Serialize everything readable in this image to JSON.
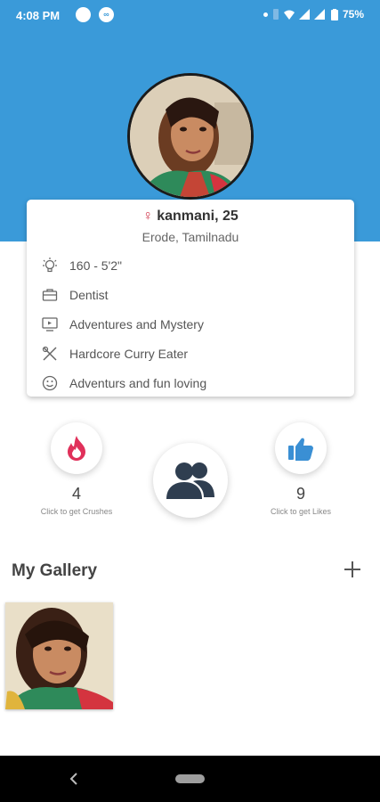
{
  "status_bar": {
    "time": "4:08 PM",
    "app_icon": "∞",
    "battery": "75%"
  },
  "profile": {
    "name_line": "kanmani, 25",
    "gender_symbol": "♀",
    "location": "Erode, Tamilnadu",
    "details": [
      {
        "icon": "bulb-icon",
        "text": "160 - 5'2\""
      },
      {
        "icon": "briefcase-icon",
        "text": "Dentist"
      },
      {
        "icon": "tv-icon",
        "text": "Adventures and Mystery"
      },
      {
        "icon": "utensils-icon",
        "text": "Hardcore Curry Eater"
      },
      {
        "icon": "smiley-icon",
        "text": "Adventurs and fun loving"
      }
    ]
  },
  "stats": {
    "crushes": {
      "count": "4",
      "caption": "Click to get Crushes"
    },
    "likes": {
      "count": "9",
      "caption": "Click to get Likes"
    }
  },
  "gallery": {
    "title": "My Gallery"
  },
  "colors": {
    "header": "#3a9ad9",
    "flame": "#e0305a",
    "thumb": "#3a8fd4",
    "people": "#2f3e50"
  }
}
